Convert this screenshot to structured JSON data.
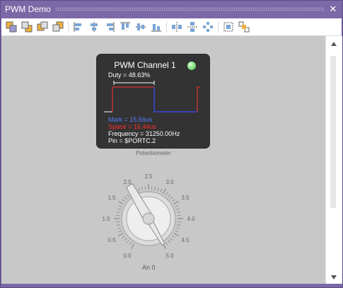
{
  "window": {
    "title": "PWM Demo",
    "close_glyph": "✕"
  },
  "toolbar": {
    "groups": [
      [
        "bring-to-front-icon",
        "send-to-back-icon",
        "bring-forward-icon",
        "send-backward-icon"
      ],
      [
        "align-left-icon",
        "align-center-icon",
        "align-right-icon",
        "align-top-icon",
        "align-middle-icon",
        "align-bottom-icon"
      ],
      [
        "distribute-horizontal-icon",
        "distribute-vertical-icon",
        "space-evenly-icon"
      ],
      [
        "group-icon",
        "ungroup-icon"
      ]
    ]
  },
  "pwm": {
    "title": "PWM Channel 1",
    "duty": "Duty = 48.63%",
    "duty_fraction": 0.4863,
    "mark": "Mark = 15.56us",
    "space": "Space = 16.44us",
    "frequency": "Frequency = 31250.00Hz",
    "pin": "Pin = $PORTC.2",
    "colors": {
      "led": "#7ee07e",
      "mark": "#4a6cff",
      "space": "#ff2a2a",
      "panel": "#333333"
    }
  },
  "potentiometer": {
    "label": "Potentiometer",
    "channel_label": "An 0",
    "scale_labels": [
      "0.0",
      "0.5",
      "1.0",
      "1.5",
      "2.0",
      "2.5",
      "3.0",
      "3.5",
      "4.0",
      "4.5",
      "5.0"
    ],
    "value": 2.0
  }
}
